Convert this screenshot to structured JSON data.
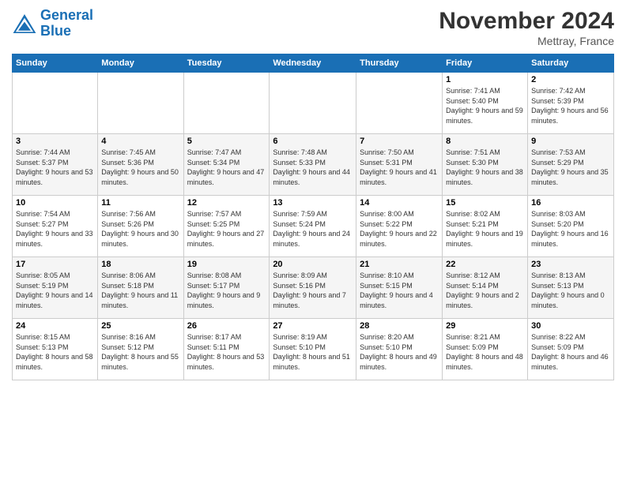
{
  "header": {
    "logo_line1": "General",
    "logo_line2": "Blue",
    "month_title": "November 2024",
    "location": "Mettray, France"
  },
  "weekdays": [
    "Sunday",
    "Monday",
    "Tuesday",
    "Wednesday",
    "Thursday",
    "Friday",
    "Saturday"
  ],
  "weeks": [
    [
      {
        "day": "",
        "info": ""
      },
      {
        "day": "",
        "info": ""
      },
      {
        "day": "",
        "info": ""
      },
      {
        "day": "",
        "info": ""
      },
      {
        "day": "",
        "info": ""
      },
      {
        "day": "1",
        "info": "Sunrise: 7:41 AM\nSunset: 5:40 PM\nDaylight: 9 hours and 59 minutes."
      },
      {
        "day": "2",
        "info": "Sunrise: 7:42 AM\nSunset: 5:39 PM\nDaylight: 9 hours and 56 minutes."
      }
    ],
    [
      {
        "day": "3",
        "info": "Sunrise: 7:44 AM\nSunset: 5:37 PM\nDaylight: 9 hours and 53 minutes."
      },
      {
        "day": "4",
        "info": "Sunrise: 7:45 AM\nSunset: 5:36 PM\nDaylight: 9 hours and 50 minutes."
      },
      {
        "day": "5",
        "info": "Sunrise: 7:47 AM\nSunset: 5:34 PM\nDaylight: 9 hours and 47 minutes."
      },
      {
        "day": "6",
        "info": "Sunrise: 7:48 AM\nSunset: 5:33 PM\nDaylight: 9 hours and 44 minutes."
      },
      {
        "day": "7",
        "info": "Sunrise: 7:50 AM\nSunset: 5:31 PM\nDaylight: 9 hours and 41 minutes."
      },
      {
        "day": "8",
        "info": "Sunrise: 7:51 AM\nSunset: 5:30 PM\nDaylight: 9 hours and 38 minutes."
      },
      {
        "day": "9",
        "info": "Sunrise: 7:53 AM\nSunset: 5:29 PM\nDaylight: 9 hours and 35 minutes."
      }
    ],
    [
      {
        "day": "10",
        "info": "Sunrise: 7:54 AM\nSunset: 5:27 PM\nDaylight: 9 hours and 33 minutes."
      },
      {
        "day": "11",
        "info": "Sunrise: 7:56 AM\nSunset: 5:26 PM\nDaylight: 9 hours and 30 minutes."
      },
      {
        "day": "12",
        "info": "Sunrise: 7:57 AM\nSunset: 5:25 PM\nDaylight: 9 hours and 27 minutes."
      },
      {
        "day": "13",
        "info": "Sunrise: 7:59 AM\nSunset: 5:24 PM\nDaylight: 9 hours and 24 minutes."
      },
      {
        "day": "14",
        "info": "Sunrise: 8:00 AM\nSunset: 5:22 PM\nDaylight: 9 hours and 22 minutes."
      },
      {
        "day": "15",
        "info": "Sunrise: 8:02 AM\nSunset: 5:21 PM\nDaylight: 9 hours and 19 minutes."
      },
      {
        "day": "16",
        "info": "Sunrise: 8:03 AM\nSunset: 5:20 PM\nDaylight: 9 hours and 16 minutes."
      }
    ],
    [
      {
        "day": "17",
        "info": "Sunrise: 8:05 AM\nSunset: 5:19 PM\nDaylight: 9 hours and 14 minutes."
      },
      {
        "day": "18",
        "info": "Sunrise: 8:06 AM\nSunset: 5:18 PM\nDaylight: 9 hours and 11 minutes."
      },
      {
        "day": "19",
        "info": "Sunrise: 8:08 AM\nSunset: 5:17 PM\nDaylight: 9 hours and 9 minutes."
      },
      {
        "day": "20",
        "info": "Sunrise: 8:09 AM\nSunset: 5:16 PM\nDaylight: 9 hours and 7 minutes."
      },
      {
        "day": "21",
        "info": "Sunrise: 8:10 AM\nSunset: 5:15 PM\nDaylight: 9 hours and 4 minutes."
      },
      {
        "day": "22",
        "info": "Sunrise: 8:12 AM\nSunset: 5:14 PM\nDaylight: 9 hours and 2 minutes."
      },
      {
        "day": "23",
        "info": "Sunrise: 8:13 AM\nSunset: 5:13 PM\nDaylight: 9 hours and 0 minutes."
      }
    ],
    [
      {
        "day": "24",
        "info": "Sunrise: 8:15 AM\nSunset: 5:13 PM\nDaylight: 8 hours and 58 minutes."
      },
      {
        "day": "25",
        "info": "Sunrise: 8:16 AM\nSunset: 5:12 PM\nDaylight: 8 hours and 55 minutes."
      },
      {
        "day": "26",
        "info": "Sunrise: 8:17 AM\nSunset: 5:11 PM\nDaylight: 8 hours and 53 minutes."
      },
      {
        "day": "27",
        "info": "Sunrise: 8:19 AM\nSunset: 5:10 PM\nDaylight: 8 hours and 51 minutes."
      },
      {
        "day": "28",
        "info": "Sunrise: 8:20 AM\nSunset: 5:10 PM\nDaylight: 8 hours and 49 minutes."
      },
      {
        "day": "29",
        "info": "Sunrise: 8:21 AM\nSunset: 5:09 PM\nDaylight: 8 hours and 48 minutes."
      },
      {
        "day": "30",
        "info": "Sunrise: 8:22 AM\nSunset: 5:09 PM\nDaylight: 8 hours and 46 minutes."
      }
    ]
  ]
}
